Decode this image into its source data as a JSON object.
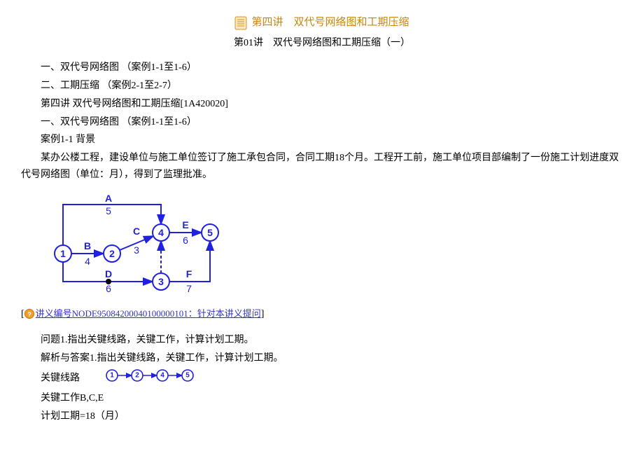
{
  "header": {
    "main_title": "第四讲　双代号网络图和工期压缩",
    "subtitle": "第01讲　双代号网络图和工期压缩（一）"
  },
  "outline": {
    "line1": "一、双代号网络图 （案例1-1至1-6）",
    "line2": "二、工期压缩 （案例2-1至2-7）",
    "line3": "第四讲 双代号网络图和工期压缩[1A420020]",
    "line4": "一、双代号网络图 （案例1-1至1-6）",
    "case_title": "案例1-1 背景",
    "case_body": "某办公楼工程，建设单位与施工单位签订了施工承包合同，合同工期18个月。工程开工前，施工单位项目部编制了一份施工计划进度双代号网络图（单位：月），得到了监理批准。"
  },
  "chart_data": {
    "type": "network-diagram",
    "nodes": [
      1,
      2,
      3,
      4,
      5
    ],
    "activities": [
      {
        "name": "A",
        "from": 1,
        "to": 4,
        "duration": 5
      },
      {
        "name": "B",
        "from": 1,
        "to": 2,
        "duration": 4
      },
      {
        "name": "C",
        "from": 2,
        "to": 4,
        "duration": 3
      },
      {
        "name": "D",
        "from": 1,
        "to": 3,
        "duration": 6
      },
      {
        "name": "E",
        "from": 4,
        "to": 5,
        "duration": 6
      },
      {
        "name": "F",
        "from": 3,
        "to": 5,
        "duration": 7
      }
    ],
    "dummy": [
      {
        "from": 3,
        "to": 4
      }
    ]
  },
  "feedback": {
    "prefix": "[",
    "link_text": "讲义编号NODE95084200040100000101：针对本讲义提问",
    "suffix": "]"
  },
  "qa": {
    "q1": "问题1.指出关键线路，关键工作，计算计划工期。",
    "a1_line1": "解析与答案1.指出关键线路，关键工作，计算计划工期。",
    "a1_path_label": "关键线路",
    "critical_path_nodes": [
      1,
      2,
      4,
      5
    ],
    "a1_line3": "关键工作B,C,E",
    "a1_line4": "计划工期=18（月）"
  }
}
